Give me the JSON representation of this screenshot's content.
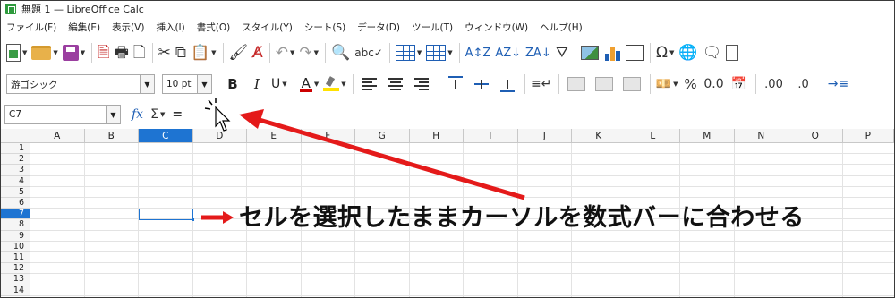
{
  "window": {
    "title": "無題 1 — LibreOffice Calc"
  },
  "menu": [
    "ファイル(F)",
    "編集(E)",
    "表示(V)",
    "挿入(I)",
    "書式(O)",
    "スタイル(Y)",
    "シート(S)",
    "データ(D)",
    "ツール(T)",
    "ウィンドウ(W)",
    "ヘルプ(H)"
  ],
  "toolbar_format": {
    "font_name": "游ゴシック",
    "font_size": "10 pt",
    "bold": "B",
    "italic": "I",
    "underline": "U",
    "font_color": "A",
    "percent": "%",
    "decimal_zero": "0.0",
    "add_decimal": ".00",
    "remove_decimal": ".0"
  },
  "formula_bar": {
    "name_box": "C7",
    "fx": "fx",
    "sigma": "Σ",
    "equals": "=",
    "content": ""
  },
  "grid": {
    "columns": [
      "A",
      "B",
      "C",
      "D",
      "E",
      "F",
      "G",
      "H",
      "I",
      "J",
      "K",
      "L",
      "M",
      "N",
      "O",
      "P"
    ],
    "rows": [
      "1",
      "2",
      "3",
      "4",
      "5",
      "6",
      "7",
      "8",
      "9",
      "10",
      "11",
      "12",
      "13",
      "14"
    ],
    "active_column": "C",
    "active_row": "7",
    "selection_color": "#1e74d2"
  },
  "annotation": {
    "text": "セルを選択したままカーソルを数式バーに合わせる",
    "arrow_color": "#e41a1a"
  },
  "colors": {
    "accent": "#1e74d2",
    "calc_green": "#2e9a3d"
  }
}
